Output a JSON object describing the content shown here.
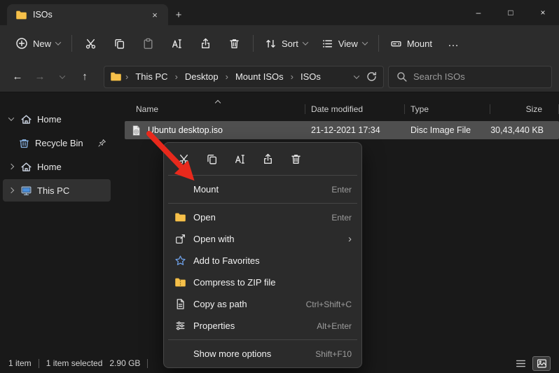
{
  "window": {
    "tab_title": "ISOs"
  },
  "glyphs": {
    "plus": "+",
    "close": "×",
    "minimize": "–",
    "maximize": "□",
    "back": "←",
    "forward": "→",
    "up": "↑",
    "crumb_sep": "›",
    "more": "…"
  },
  "toolbar": {
    "new": "New",
    "sort": "Sort",
    "view": "View",
    "mount": "Mount"
  },
  "address": {
    "crumbs": [
      "This PC",
      "Desktop",
      "Mount ISOs",
      "ISOs"
    ]
  },
  "search": {
    "placeholder": "Search ISOs"
  },
  "sidebar": {
    "items": [
      {
        "label": "Home"
      },
      {
        "label": "Recycle Bin"
      },
      {
        "label": "Home"
      },
      {
        "label": "This PC"
      }
    ]
  },
  "files": {
    "columns": [
      "Name",
      "Date modified",
      "Type",
      "Size"
    ],
    "rows": [
      {
        "name": "Ubuntu desktop.iso",
        "date": "21-12-2021 17:34",
        "type": "Disc Image File",
        "size": "30,43,440 KB",
        "selected": true
      }
    ]
  },
  "menu": {
    "items": [
      {
        "label": "Mount",
        "shortcut": "Enter"
      },
      {
        "label": "Open",
        "shortcut": "Enter"
      },
      {
        "label": "Open with",
        "submenu": "›"
      },
      {
        "label": "Add to Favorites"
      },
      {
        "label": "Compress to ZIP file"
      },
      {
        "label": "Copy as path",
        "shortcut": "Ctrl+Shift+C"
      },
      {
        "label": "Properties",
        "shortcut": "Alt+Enter"
      },
      {
        "label": "Show more options",
        "shortcut": "Shift+F10"
      }
    ]
  },
  "status": {
    "count": "1 item",
    "selected": "1 item selected",
    "size": "2.90 GB"
  },
  "colors": {
    "arrow_red": "#e8291c",
    "folder_yellow": "#f6c04a",
    "selection_gray": "#4f4f4f"
  }
}
